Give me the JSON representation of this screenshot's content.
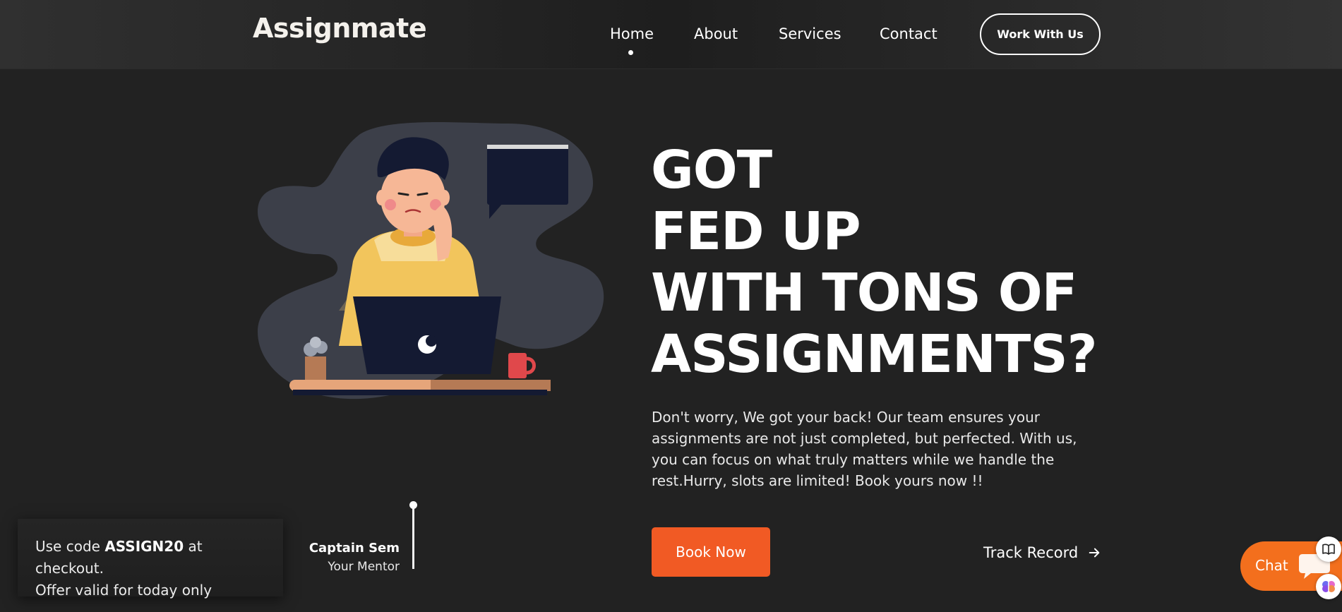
{
  "header": {
    "logo_text": "Assignmate",
    "nav": [
      {
        "label": "Home",
        "active": true
      },
      {
        "label": "About"
      },
      {
        "label": "Services"
      },
      {
        "label": "Contact"
      }
    ],
    "cta_label": "Work With Us"
  },
  "hero": {
    "headline_lines": [
      "GOT",
      "FED UP",
      "WITH TONS OF",
      "ASSIGNMENTS?"
    ],
    "description": "Don't worry, We got your back! Our team ensures your assignments are not just completed, but perfected. With us, you can focus on what truly matters while we handle the rest.Hurry, slots are limited! Book yours now !!",
    "book_label": "Book Now",
    "track_label": "Track Record"
  },
  "mentor": {
    "name": "Captain Sem",
    "role": "Your Mentor"
  },
  "promo": {
    "prefix": "Use code ",
    "code": "ASSIGN20",
    "suffix": " at checkout.",
    "line2": "Offer valid for today only"
  },
  "chat": {
    "label": "Chat"
  },
  "colors": {
    "background": "#222222",
    "accent_orange": "#f15a24",
    "logo_accent": "#f39c28",
    "chat_orange": "#f36f1d"
  },
  "icons": [
    "arrow-right-icon",
    "chat-bubble-icon",
    "book-icon",
    "brain-icon"
  ]
}
